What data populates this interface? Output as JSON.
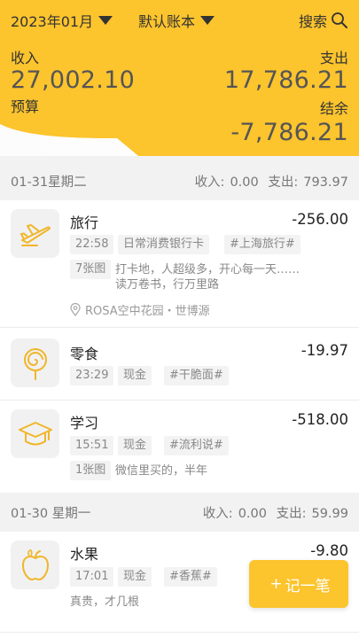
{
  "topbar": {
    "month": "2023年01月",
    "account_book": "默认账本",
    "search_label": "搜索"
  },
  "summary": {
    "income_label": "收入",
    "income_value": "27,002.10",
    "expense_label": "支出",
    "expense_value": "17,786.21",
    "budget_label": "预算",
    "balance_label": "结余",
    "balance_value": "-7,786.21"
  },
  "colors": {
    "accent": "#fcc42d",
    "background": "#f2f2f2"
  },
  "days": [
    {
      "date": "01-31星期二",
      "income_label": "收入:",
      "income": "0.00",
      "expense_label": "支出:",
      "expense": "793.97",
      "entries": [
        {
          "icon": "airplane-icon",
          "title": "旅行",
          "amount": "-256.00",
          "time": "22:58",
          "account": "日常消费银行卡",
          "tag": "#上海旅行#",
          "images": "7张图",
          "note_line1": "打卡地，人超级多，开心每一天……",
          "note_line2": "读万卷书，行万里路",
          "location": "ROSA空中花园・世博源"
        },
        {
          "icon": "lollipop-icon",
          "title": "零食",
          "amount": "-19.97",
          "time": "23:29",
          "account": "现金",
          "tag": "#干脆面#"
        },
        {
          "icon": "graduation-cap-icon",
          "title": "学习",
          "amount": "-518.00",
          "time": "15:51",
          "account": "现金",
          "tag": "#流利说#",
          "images": "1张图",
          "note_line1": "微信里买的，半年"
        }
      ]
    },
    {
      "date": "01-30 星期一",
      "income_label": "收入:",
      "income": "0.00",
      "expense_label": "支出:",
      "expense": "59.99",
      "entries": [
        {
          "icon": "apple-icon",
          "title": "水果",
          "amount": "-9.80",
          "time": "17:01",
          "account": "现金",
          "tag": "#香蕉#",
          "note_line1": "真贵，才几根"
        }
      ]
    }
  ],
  "fab": {
    "plus": "+",
    "label": "记一笔"
  }
}
